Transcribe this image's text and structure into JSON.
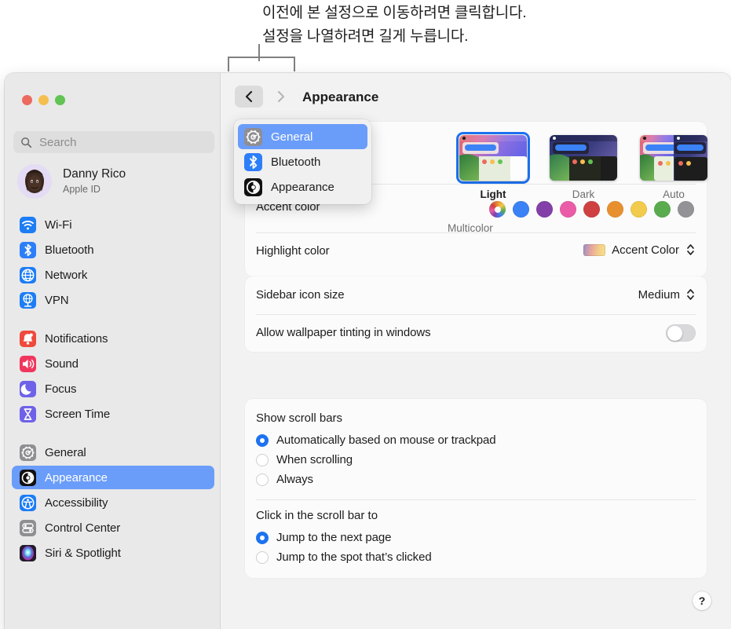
{
  "callout": {
    "line1": "이전에 본 설정으로 이동하려면 클릭합니다.",
    "line2": "설정을 나열하려면 길게 누릅니다."
  },
  "window": {
    "traffic_lights": [
      "close-red",
      "minimize-yellow",
      "zoom-green"
    ]
  },
  "sidebar": {
    "search": {
      "placeholder": "Search"
    },
    "profile": {
      "name": "Danny Rico",
      "subtitle": "Apple ID",
      "avatar": "memoji-avatar"
    },
    "groups": [
      {
        "items": [
          {
            "label": "Wi-Fi",
            "icon": "wifi-icon",
            "color": "#1d7df5",
            "selected": false
          },
          {
            "label": "Bluetooth",
            "icon": "bluetooth-icon",
            "color": "#2d7ff9",
            "selected": false
          },
          {
            "label": "Network",
            "icon": "globe-icon",
            "color": "#1d7df5",
            "selected": false
          },
          {
            "label": "VPN",
            "icon": "vpn-icon",
            "color": "#1d7df5",
            "selected": false
          }
        ]
      },
      {
        "items": [
          {
            "label": "Notifications",
            "icon": "bell-icon",
            "color": "#ef4a3c",
            "selected": false
          },
          {
            "label": "Sound",
            "icon": "speaker-icon",
            "color": "#f0365c",
            "selected": false
          },
          {
            "label": "Focus",
            "icon": "moon-icon",
            "color": "#6e62e8",
            "selected": false
          },
          {
            "label": "Screen Time",
            "icon": "hourglass-icon",
            "color": "#6e62e8",
            "selected": false
          }
        ]
      },
      {
        "items": [
          {
            "label": "General",
            "icon": "gear-icon",
            "color": "#8e8e93",
            "selected": false
          },
          {
            "label": "Appearance",
            "icon": "appearance-icon",
            "color": "#111111",
            "selected": true
          },
          {
            "label": "Accessibility",
            "icon": "accessibility-icon",
            "color": "#1d7df5",
            "selected": false
          },
          {
            "label": "Control Center",
            "icon": "control-center-icon",
            "color": "#8e8e93",
            "selected": false
          },
          {
            "label": "Siri & Spotlight",
            "icon": "siri-icon",
            "color": "#2a2036",
            "selected": false
          }
        ]
      }
    ]
  },
  "toolbar": {
    "back_label": "back-chevron",
    "forward_label": "forward-chevron",
    "title": "Appearance"
  },
  "dropdown": {
    "items": [
      {
        "label": "General",
        "icon": "gear-icon",
        "color": "#8e8e93",
        "selected": true
      },
      {
        "label": "Bluetooth",
        "icon": "bluetooth-icon",
        "color": "#2d7ff9",
        "selected": false
      },
      {
        "label": "Appearance",
        "icon": "appearance-icon",
        "color": "#111111",
        "selected": false
      }
    ]
  },
  "appearance": {
    "modes": [
      {
        "label": "Light",
        "selected": true
      },
      {
        "label": "Dark",
        "selected": false
      },
      {
        "label": "Auto",
        "selected": false
      }
    ],
    "accent": {
      "label": "Accent color",
      "caption": "Multicolor",
      "swatches": [
        {
          "name": "multicolor",
          "color": "multicolor"
        },
        {
          "name": "blue",
          "color": "#3b82f6"
        },
        {
          "name": "purple",
          "color": "#8340a8"
        },
        {
          "name": "pink",
          "color": "#ea5ca8"
        },
        {
          "name": "red",
          "color": "#cf4040"
        },
        {
          "name": "orange",
          "color": "#e8902f"
        },
        {
          "name": "yellow",
          "color": "#f2ca4c"
        },
        {
          "name": "green",
          "color": "#5aab4e"
        },
        {
          "name": "graphite",
          "color": "#939397"
        }
      ]
    },
    "highlight": {
      "label": "Highlight color",
      "value": "Accent Color"
    },
    "sidebar_icon_size": {
      "label": "Sidebar icon size",
      "value": "Medium"
    },
    "wallpaper_tinting": {
      "label": "Allow wallpaper tinting in windows",
      "on": false
    }
  },
  "scrollbars": {
    "show_title": "Show scroll bars",
    "show_options": [
      {
        "label": "Automatically based on mouse or trackpad",
        "selected": true
      },
      {
        "label": "When scrolling",
        "selected": false
      },
      {
        "label": "Always",
        "selected": false
      }
    ],
    "click_title": "Click in the scroll bar to",
    "click_options": [
      {
        "label": "Jump to the next page",
        "selected": true
      },
      {
        "label": "Jump to the spot that’s clicked",
        "selected": false
      }
    ]
  },
  "help": {
    "label": "?"
  }
}
